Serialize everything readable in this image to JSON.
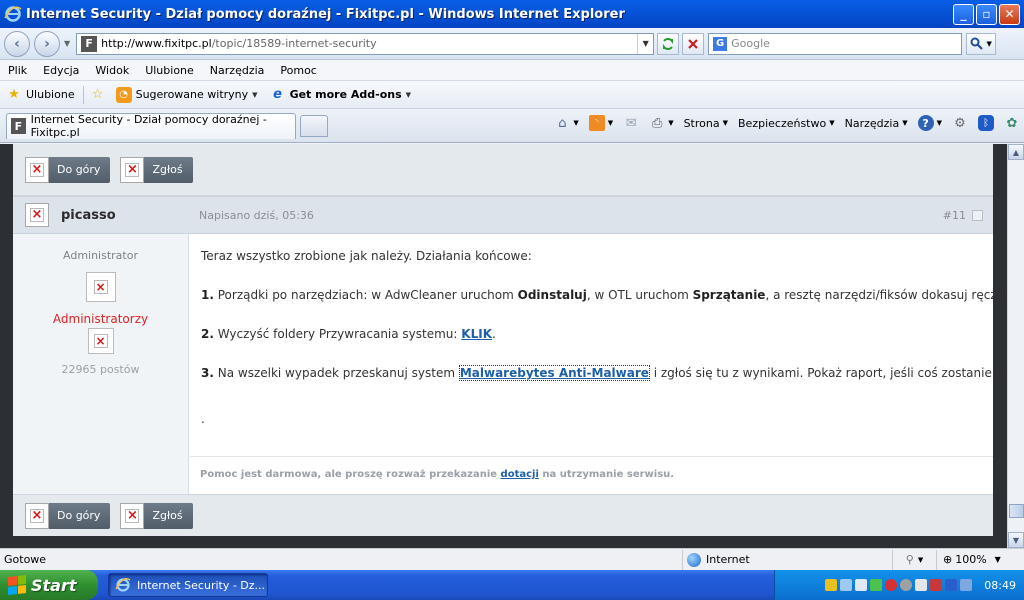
{
  "window": {
    "title": "Internet Security - Dział pomocy doraźnej - Fixitpc.pl - Windows Internet Explorer",
    "controls": {
      "minimize": "_",
      "maximize": "▫",
      "close": "✕"
    }
  },
  "nav": {
    "back": "‹",
    "forward": "›",
    "favicon": "F",
    "url_host": "http://www.fixitpc.pl",
    "url_path": "/topic/18589-internet-security",
    "search_placeholder": "Google",
    "search_engine_letter": "G"
  },
  "menu": [
    "Plik",
    "Edycja",
    "Widok",
    "Ulubione",
    "Narzędzia",
    "Pomoc"
  ],
  "favorites_bar": {
    "favorites_label": "Ulubione",
    "suggested_label": "Sugerowane witryny",
    "addons_label": "Get more Add-ons"
  },
  "tab": {
    "title": "Internet Security - Dział pomocy doraźnej - Fixitpc.pl",
    "favicon": "F"
  },
  "command_bar": {
    "page": "Strona",
    "safety": "Bezpieczeństwo",
    "tools": "Narzędzia",
    "help": "?"
  },
  "post_controls": {
    "top_label": "Do góry",
    "report_label": "Zgłoś"
  },
  "post": {
    "author": "picasso",
    "date": "Napisano dziś, 05:36",
    "number": "#11",
    "author_title": "Administrator",
    "group": "Administratorzy",
    "post_count": "22965 postów",
    "intro": "Teraz wszystko zrobione jak należy. Działania końcowe:",
    "item1": {
      "num": "1.",
      "t1": " Porządki po narzędziach: w AdwCleaner uruchom ",
      "b1": "Odinstaluj",
      "t2": ", w OTL uruchom ",
      "b2": "Sprzątanie",
      "t3": ", a resztę narzędzi/fiksów dokasuj ręcznie."
    },
    "item2": {
      "num": "2.",
      "t1": " Wyczyść foldery Przywracania systemu: ",
      "link": "KLIK",
      "t2": "."
    },
    "item3": {
      "num": "3.",
      "t1": " Na wszelki wypadek przeskanuj system ",
      "link": "Malwarebytes Anti-Malware",
      "t2": " i zgłoś się tu z wynikami. Pokaż raport, jeśli coś zostanie wykryte."
    },
    "dot": ".",
    "signature": {
      "t1": "Pomoc jest darmowa, ale proszę rozważ przekazanie ",
      "link": "dotacji",
      "t2": " na utrzymanie serwisu."
    }
  },
  "statusbar": {
    "status": "Gotowe",
    "zone": "Internet",
    "zoom": "100%"
  },
  "taskbar": {
    "start": "Start",
    "task": "Internet Security - Dz...",
    "clock": "08:49"
  },
  "colors": {
    "titlebar": "#0554d8",
    "link": "#1d5fa8",
    "group": "#d22222",
    "start_green": "#2f8f2f"
  }
}
